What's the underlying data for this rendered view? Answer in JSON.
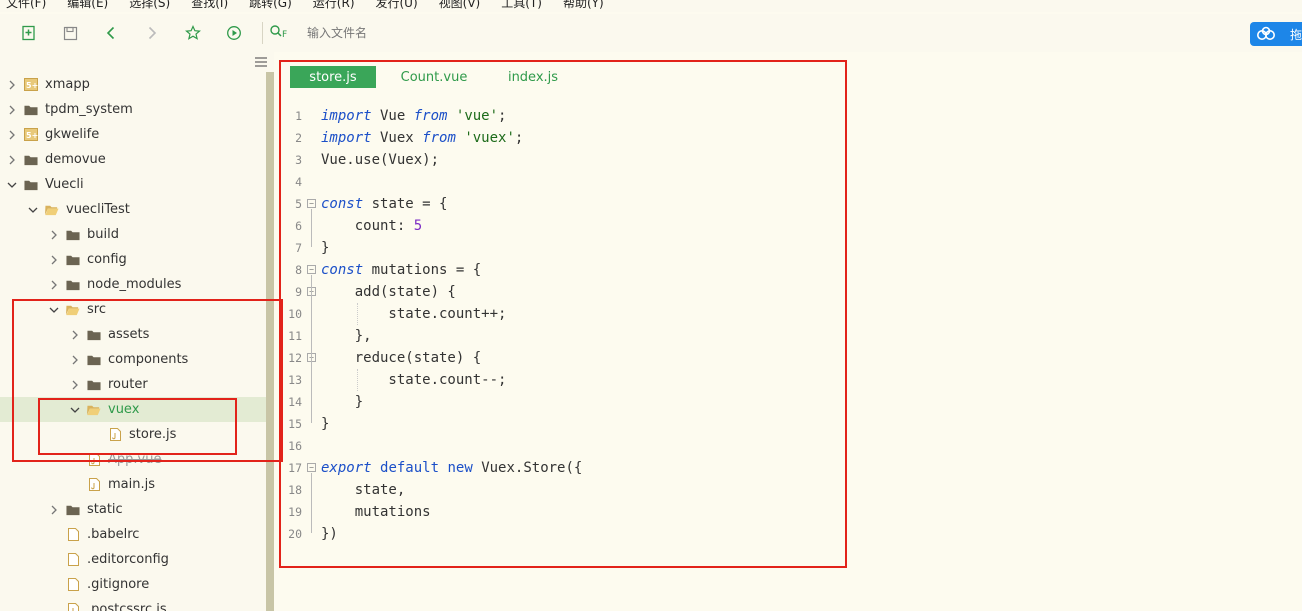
{
  "menu": [
    "文件(F)",
    "编辑(E)",
    "选择(S)",
    "查找(I)",
    "跳转(G)",
    "运行(R)",
    "发行(U)",
    "视图(V)",
    "工具(T)",
    "帮助(Y)"
  ],
  "toolbar": {
    "search_placeholder": "输入文件名",
    "search_hint": "F",
    "cloud_label": "拖"
  },
  "tree": [
    {
      "label": "xmapp",
      "type": "project"
    },
    {
      "label": "tpdm_system",
      "type": "folder"
    },
    {
      "label": "gkwelife",
      "type": "project"
    },
    {
      "label": "demovue",
      "type": "folder"
    },
    {
      "label": "Vuecli",
      "type": "folder"
    },
    {
      "label": "vuecliTest",
      "type": "folder"
    },
    {
      "label": "build",
      "type": "folder"
    },
    {
      "label": "config",
      "type": "folder"
    },
    {
      "label": "node_modules",
      "type": "folder"
    },
    {
      "label": "src",
      "type": "folder"
    },
    {
      "label": "assets",
      "type": "folder"
    },
    {
      "label": "components",
      "type": "folder"
    },
    {
      "label": "router",
      "type": "folder"
    },
    {
      "label": "vuex",
      "type": "folder"
    },
    {
      "label": "store.js",
      "type": "file"
    },
    {
      "label": "App.vue",
      "type": "file"
    },
    {
      "label": "main.js",
      "type": "file"
    },
    {
      "label": "static",
      "type": "folder"
    },
    {
      "label": ".babelrc",
      "type": "file"
    },
    {
      "label": ".editorconfig",
      "type": "file"
    },
    {
      "label": ".gitignore",
      "type": "file"
    },
    {
      "label": ".postcssrc.js",
      "type": "file"
    }
  ],
  "editor": {
    "tabs": [
      "store.js",
      "Count.vue",
      "index.js"
    ],
    "active_tab": "store.js",
    "lines": [
      "import Vue from 'vue';",
      "import Vuex from 'vuex';",
      "Vue.use(Vuex);",
      "",
      "const state = {",
      "    count: 5",
      "}",
      "const mutations = {",
      "    add(state) {",
      "        state.count++;",
      "    },",
      "    reduce(state) {",
      "        state.count--;",
      "    }",
      "}",
      "",
      "export default new Vuex.Store({",
      "    state,",
      "    mutations",
      "})"
    ]
  },
  "colors": {
    "accent": "#3aa659",
    "highlight_box": "#e2231a",
    "keyword": "#1b4fc8",
    "string": "#1d6b1a",
    "number": "#7c2cc4"
  }
}
